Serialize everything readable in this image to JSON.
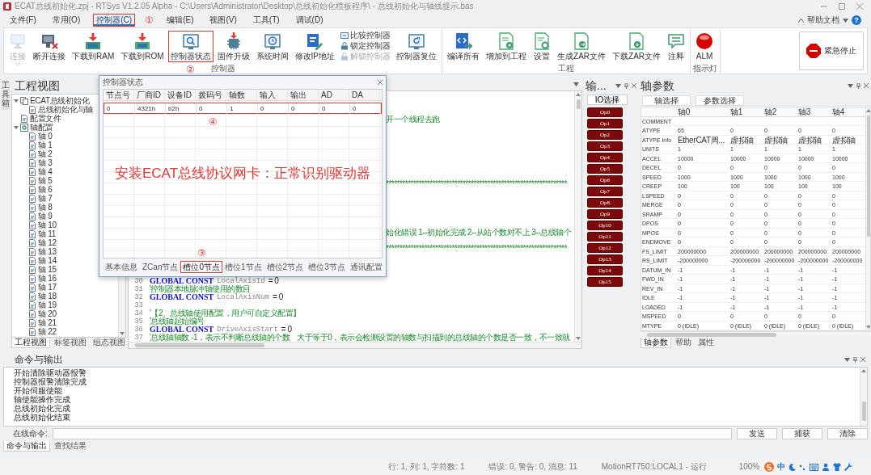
{
  "window": {
    "title": "ECAT总线初始化.zpj - RTSys V1.2.05 Alpha - C:\\Users\\Administrator\\Desktop\\总线初始化模板程序\\ - 总线初始化与轴线提示.bas"
  },
  "menu": [
    {
      "label": "文件(F)",
      "selected": false,
      "highlighted": false
    },
    {
      "label": "常用(O)",
      "selected": false,
      "highlighted": false
    },
    {
      "label": "控制器(C)",
      "selected": true,
      "highlighted": true,
      "annotation": "①"
    },
    {
      "label": "编辑(E)",
      "selected": false,
      "highlighted": false
    },
    {
      "label": "视图(V)",
      "selected": false,
      "highlighted": false
    },
    {
      "label": "工具(T)",
      "selected": false,
      "highlighted": false
    },
    {
      "label": "调试(D)",
      "selected": false,
      "highlighted": false
    }
  ],
  "help": {
    "label": "帮助文档",
    "glyph": "?"
  },
  "ribbon": {
    "groups": [
      {
        "label": "控制器",
        "items": [
          {
            "kind": "large",
            "label": "连接",
            "disabled": true,
            "highlighted": false,
            "dropdown": true
          },
          {
            "kind": "large",
            "label": "断开连接",
            "disabled": false,
            "highlighted": false
          },
          {
            "kind": "large",
            "label": "下载到RAM",
            "disabled": false,
            "highlighted": false
          },
          {
            "kind": "large",
            "label": "下载到ROM",
            "disabled": false,
            "highlighted": false
          },
          {
            "kind": "large",
            "label": "控制器状态",
            "disabled": false,
            "highlighted": true,
            "annotation": "②"
          },
          {
            "kind": "large",
            "label": "固件升级",
            "disabled": false,
            "highlighted": false
          },
          {
            "kind": "large",
            "label": "系统时间",
            "disabled": false,
            "highlighted": false
          },
          {
            "kind": "large",
            "label": "修改IP地址",
            "disabled": false,
            "highlighted": false
          },
          {
            "kind": "stack",
            "entries": [
              {
                "label": "比较控制器",
                "disabled": false
              },
              {
                "label": "锁定控制器",
                "disabled": false
              },
              {
                "label": "解锁控制器",
                "disabled": true
              }
            ]
          },
          {
            "kind": "large",
            "label": "控制器复位",
            "disabled": false,
            "highlighted": false
          }
        ]
      },
      {
        "label": "工程",
        "items": [
          {
            "kind": "large",
            "label": "编译所有",
            "disabled": false,
            "highlighted": false
          },
          {
            "kind": "large",
            "label": "增加到工程",
            "disabled": false,
            "highlighted": false
          },
          {
            "kind": "large",
            "label": "设置",
            "disabled": false,
            "highlighted": false
          },
          {
            "kind": "large",
            "label": "生成ZAR文件",
            "disabled": false,
            "highlighted": false
          },
          {
            "kind": "large",
            "label": "下载ZAR文件",
            "disabled": false,
            "highlighted": false
          },
          {
            "kind": "large",
            "label": "注释",
            "disabled": false,
            "highlighted": false
          }
        ]
      },
      {
        "label": "指示灯",
        "items": [
          {
            "kind": "large",
            "label": "ALM",
            "disabled": false,
            "highlighted": false
          }
        ]
      }
    ],
    "emergency_stop": {
      "label": "紧急停止"
    }
  },
  "project_view": {
    "title": "工程视图",
    "toolbox_label": "工具箱",
    "tree": [
      {
        "label": "ECAT总线初始化",
        "expanded": true,
        "children": [
          {
            "label": "总线初始化与轴"
          }
        ]
      },
      {
        "label": "配置文件"
      },
      {
        "label": "轴配置",
        "expanded": true,
        "children": [
          {
            "label": "轴 0"
          },
          {
            "label": "轴 1"
          },
          {
            "label": "轴 2"
          },
          {
            "label": "轴 3"
          },
          {
            "label": "轴 4"
          },
          {
            "label": "轴 5"
          },
          {
            "label": "轴 6"
          },
          {
            "label": "轴 7"
          },
          {
            "label": "轴 8"
          },
          {
            "label": "轴 9"
          },
          {
            "label": "轴 10"
          },
          {
            "label": "轴 11"
          },
          {
            "label": "轴 12"
          },
          {
            "label": "轴 13"
          },
          {
            "label": "轴 14"
          },
          {
            "label": "轴 15"
          },
          {
            "label": "轴 16"
          },
          {
            "label": "轴 17"
          },
          {
            "label": "轴 18"
          },
          {
            "label": "轴 19"
          },
          {
            "label": "轴 20"
          },
          {
            "label": "轴 21"
          },
          {
            "label": "轴 22"
          }
        ]
      }
    ],
    "tabs": [
      {
        "label": "工程视图",
        "selected": true
      },
      {
        "label": "标签视图",
        "selected": false
      },
      {
        "label": "组态视图",
        "selected": false
      }
    ]
  },
  "editor": {
    "rows": [
      {
        "kind": "covered"
      },
      {
        "kind": "covered"
      },
      {
        "kind": "covered"
      },
      {
        "kind": "fragment",
        "text": "开一个线程去跑"
      },
      {
        "kind": "covered"
      },
      {
        "kind": "covered"
      },
      {
        "kind": "covered"
      },
      {
        "kind": "covered"
      },
      {
        "kind": "covered"
      },
      {
        "kind": "covered"
      },
      {
        "kind": "covered"
      },
      {
        "kind": "fragment",
        "text": "******************************************************************"
      },
      {
        "kind": "covered"
      },
      {
        "kind": "covered"
      },
      {
        "kind": "covered"
      },
      {
        "kind": "covered"
      },
      {
        "kind": "covered"
      },
      {
        "kind": "fragment",
        "text": "始化错误 1--初始化完成 2--从站个数对不上 3--总线轴个"
      },
      {
        "kind": "covered"
      },
      {
        "kind": "fragment",
        "text": "******************************************************************"
      },
      {
        "kind": "covered"
      },
      {
        "kind": "covered"
      },
      {
        "kind": "covered"
      },
      {
        "kind": "code",
        "number": "30",
        "segments": [
          {
            "kind": "keyword",
            "text": "GLOBAL CONST"
          },
          {
            "kind": "ident",
            "text": "LocalAxisId"
          },
          {
            "kind": "plain",
            "text": "= 0"
          }
        ]
      },
      {
        "kind": "code",
        "number": "31",
        "segments": [
          {
            "kind": "comment",
            "text": "'控制器本地脉冲轴使用的数目"
          }
        ]
      },
      {
        "kind": "code",
        "number": "32",
        "segments": [
          {
            "kind": "keyword",
            "text": "GLOBAL CONST"
          },
          {
            "kind": "ident",
            "text": "LocalAxisNum"
          },
          {
            "kind": "plain",
            "text": "= 0"
          }
        ]
      },
      {
        "kind": "code",
        "number": "33"
      },
      {
        "kind": "code",
        "number": "34",
        "segments": [
          {
            "kind": "comment",
            "text": "'【2、总线轴使用配置，用户可自定义配置】"
          }
        ]
      },
      {
        "kind": "code",
        "number": "35",
        "segments": [
          {
            "kind": "comment",
            "text": "'总线轴起始编号"
          }
        ]
      },
      {
        "kind": "code",
        "number": "36",
        "segments": [
          {
            "kind": "keyword",
            "text": "GLOBAL CONST"
          },
          {
            "kind": "ident",
            "text": "DriveAxisStart"
          },
          {
            "kind": "plain",
            "text": "= 0"
          }
        ]
      },
      {
        "kind": "code",
        "number": "37",
        "segments": [
          {
            "kind": "comment",
            "text": "'总线轴轴数 -1，表示不判断总线轴的个数    大于等于0，表示会检测设置的轴数与扫描到的总线轴的个数是否一致，不一致就"
          }
        ]
      }
    ]
  },
  "io_panel": {
    "title": "输...",
    "select_button": "IO选择",
    "outputs": [
      "Op0",
      "Op1",
      "Op2",
      "Op3",
      "Op4",
      "Op5",
      "Op6",
      "Op7",
      "Op8",
      "Op9",
      "Op10",
      "Op11",
      "Op12",
      "Op13",
      "Op14",
      "Op15"
    ]
  },
  "axis_params": {
    "title": "轴参数",
    "buttons": [
      "轴选择",
      "参数选择"
    ],
    "columns": [
      "轴0",
      "轴1",
      "轴2",
      "轴3",
      "轴4"
    ],
    "rows": [
      {
        "name": "COMMENT"
      },
      {
        "name": "ATYPE",
        "values": [
          "65",
          "0",
          "0",
          "0",
          "0"
        ]
      },
      {
        "name": "ATYPE Info",
        "values": [
          "EtherCAT周...",
          "虚拟轴",
          "虚拟轴",
          "虚拟轴",
          "虚拟轴"
        ]
      },
      {
        "name": "UNITS",
        "values": [
          "1",
          "1",
          "1",
          "1",
          "1"
        ]
      },
      {
        "name": "ACCEL",
        "values": [
          "10000",
          "10000",
          "10000",
          "10000",
          "10000"
        ]
      },
      {
        "name": "DECEL",
        "values": [
          "0",
          "0",
          "0",
          "0",
          "0"
        ]
      },
      {
        "name": "SPEED",
        "values": [
          "1000",
          "1000",
          "1000",
          "1000",
          "1000"
        ]
      },
      {
        "name": "CREEP",
        "values": [
          "100",
          "100",
          "100",
          "100",
          "100"
        ]
      },
      {
        "name": "LSPEED",
        "values": [
          "0",
          "0",
          "0",
          "0",
          "0"
        ]
      },
      {
        "name": "MERGE",
        "values": [
          "0",
          "0",
          "0",
          "0",
          "0"
        ]
      },
      {
        "name": "SRAMP",
        "values": [
          "0",
          "0",
          "0",
          "0",
          "0"
        ]
      },
      {
        "name": "DPOS",
        "values": [
          "0",
          "0",
          "0",
          "0",
          "0"
        ]
      },
      {
        "name": "MPOS",
        "values": [
          "0",
          "0",
          "0",
          "0",
          "0"
        ]
      },
      {
        "name": "ENDMOVE",
        "values": [
          "0",
          "0",
          "0",
          "0",
          "0"
        ]
      },
      {
        "name": "FS_LIMIT",
        "values": [
          "200000000",
          "200000000",
          "200000000",
          "200000000",
          "200000000"
        ]
      },
      {
        "name": "RS_LIMIT",
        "values": [
          "-200000000",
          "-200000000",
          "-200000000",
          "-200000000",
          "-200000000"
        ]
      },
      {
        "name": "DATUM_IN",
        "values": [
          "-1",
          "-1",
          "-1",
          "-1",
          "-1"
        ]
      },
      {
        "name": "FWD_IN",
        "values": [
          "-1",
          "-1",
          "-1",
          "-1",
          "-1"
        ]
      },
      {
        "name": "REV_IN",
        "values": [
          "-1",
          "-1",
          "-1",
          "-1",
          "-1"
        ]
      },
      {
        "name": "IDLE",
        "values": [
          "-1",
          "-1",
          "-1",
          "-1",
          "-1"
        ]
      },
      {
        "name": "LOADED",
        "values": [
          "-1",
          "-1",
          "-1",
          "-1",
          "-1"
        ]
      },
      {
        "name": "MSPEED",
        "values": [
          "0",
          "0",
          "0",
          "0",
          "0"
        ]
      },
      {
        "name": "MTYPE",
        "values": [
          "0 (IDLE)",
          "0 (IDLE)",
          "0 (IDLE)",
          "0 (IDLE)",
          "0 (IDLE)"
        ]
      }
    ],
    "tabs": [
      {
        "label": "轴参数",
        "selected": true
      },
      {
        "label": "帮助",
        "selected": false
      },
      {
        "label": "属性",
        "selected": false
      }
    ]
  },
  "command_output": {
    "title": "命令与输出",
    "lines": [
      "开始清除驱动器报警",
      "控制器报警清除完成",
      "开始伺服使能",
      "轴使能操作完成",
      "总线初始化完成",
      "总线初始化结束"
    ],
    "command_label": "在线命令:",
    "buttons": [
      "发送",
      "捕获",
      "清除"
    ],
    "tabs": [
      {
        "label": "命令与输出",
        "selected": true
      },
      {
        "label": "查找结果",
        "selected": false
      }
    ]
  },
  "status_bar": {
    "position": "行: 1, 列: 1, 字符数: 1",
    "messages": "错误: 0, 警告: 0, 消息: 11",
    "controller": "MotionRT750:LOCAL1 - 运行",
    "zoom": "100%",
    "ime": "中"
  },
  "dialog": {
    "title": "控制器状态",
    "columns": [
      "节点号",
      "厂商ID",
      "设备ID",
      "拨码号",
      "轴数",
      "输入",
      "输出",
      "AD",
      "DA"
    ],
    "rows": [
      {
        "cells": [
          "0",
          "4321h",
          "b2h",
          "0",
          "1",
          "0",
          "0",
          "0",
          "0"
        ],
        "highlighted": true,
        "annotation": "④"
      }
    ],
    "caption": "安装ECAT总线协议网卡：正常识别驱动器",
    "tabs": [
      {
        "label": "基本信息",
        "selected": false,
        "highlighted": false
      },
      {
        "label": "ZCan节点",
        "selected": false,
        "highlighted": false
      },
      {
        "label": "槽位0节点",
        "selected": true,
        "highlighted": true,
        "annotation": "③"
      },
      {
        "label": "槽位1节点",
        "selected": false,
        "highlighted": false
      },
      {
        "label": "槽位2节点",
        "selected": false,
        "highlighted": false
      },
      {
        "label": "槽位3节点",
        "selected": false,
        "highlighted": false
      },
      {
        "label": "通讯配置",
        "selected": false,
        "highlighted": false
      }
    ]
  }
}
